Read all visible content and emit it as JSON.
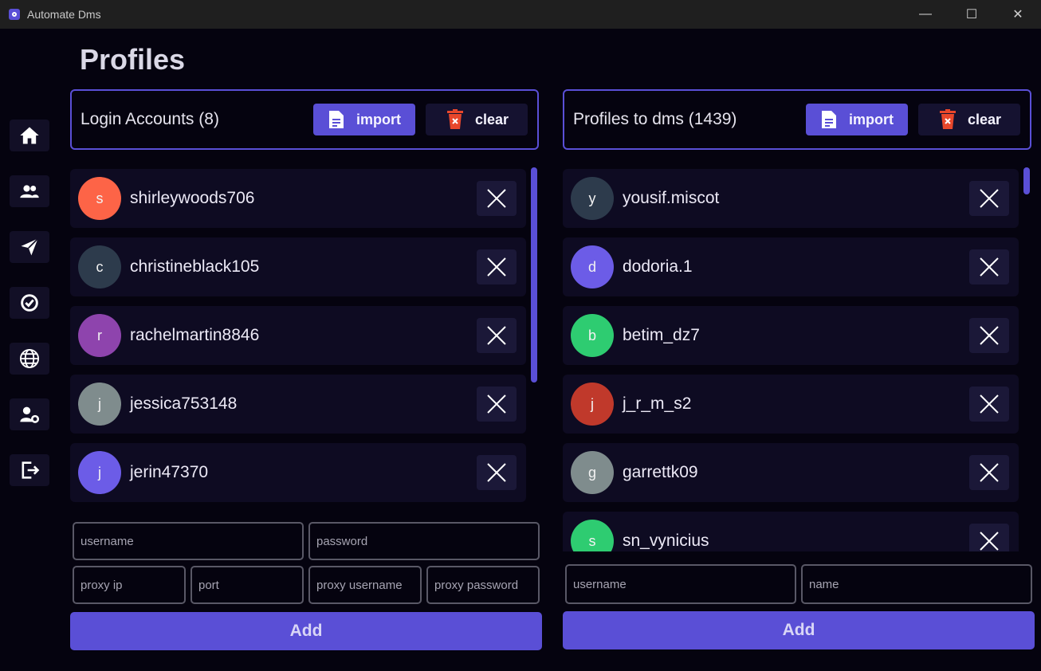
{
  "window": {
    "title": "Automate Dms",
    "minimize": "—",
    "maximize": "☐",
    "close": "✕"
  },
  "page": {
    "title": "Profiles"
  },
  "colors": {
    "accent": "#5a4fd6",
    "background": "#05030f",
    "card": "#0e0b22"
  },
  "sidebar": {
    "items": [
      {
        "icon": "home-icon"
      },
      {
        "icon": "users-icon"
      },
      {
        "icon": "send-icon"
      },
      {
        "icon": "check-circle-icon"
      },
      {
        "icon": "globe-icon"
      },
      {
        "icon": "user-settings-icon"
      },
      {
        "icon": "logout-icon"
      }
    ]
  },
  "login_accounts": {
    "title": "Login Accounts (8)",
    "import_label": "import",
    "clear_label": "clear",
    "items": [
      {
        "initial": "s",
        "username": "shirleywoods706",
        "color": "#fd6447"
      },
      {
        "initial": "c",
        "username": "christineblack105",
        "color": "#2d3b4c"
      },
      {
        "initial": "r",
        "username": "rachelmartin8846",
        "color": "#8e44ad"
      },
      {
        "initial": "j",
        "username": "jessica753148",
        "color": "#7f8c8d"
      },
      {
        "initial": "j",
        "username": "jerin47370",
        "color": "#6c5ce7"
      }
    ],
    "form": {
      "username_placeholder": "username",
      "password_placeholder": "password",
      "proxy_ip_placeholder": "proxy ip",
      "port_placeholder": "port",
      "proxy_username_placeholder": "proxy username",
      "proxy_password_placeholder": "proxy password",
      "add_label": "Add"
    }
  },
  "profiles_to_dms": {
    "title": "Profiles to dms (1439)",
    "import_label": "import",
    "clear_label": "clear",
    "items": [
      {
        "initial": "y",
        "username": "yousif.miscot",
        "color": "#2d3b4c"
      },
      {
        "initial": "d",
        "username": "dodoria.1",
        "color": "#6c5ce7"
      },
      {
        "initial": "b",
        "username": "betim_dz7",
        "color": "#2ecc71"
      },
      {
        "initial": "j",
        "username": "j_r_m_s2",
        "color": "#c0392b"
      },
      {
        "initial": "g",
        "username": "garrettk09",
        "color": "#7f8c8d"
      },
      {
        "initial": "s",
        "username": "sn_vynicius",
        "color": "#2ecc71"
      }
    ],
    "form": {
      "username_placeholder": "username",
      "name_placeholder": "name",
      "add_label": "Add"
    }
  }
}
